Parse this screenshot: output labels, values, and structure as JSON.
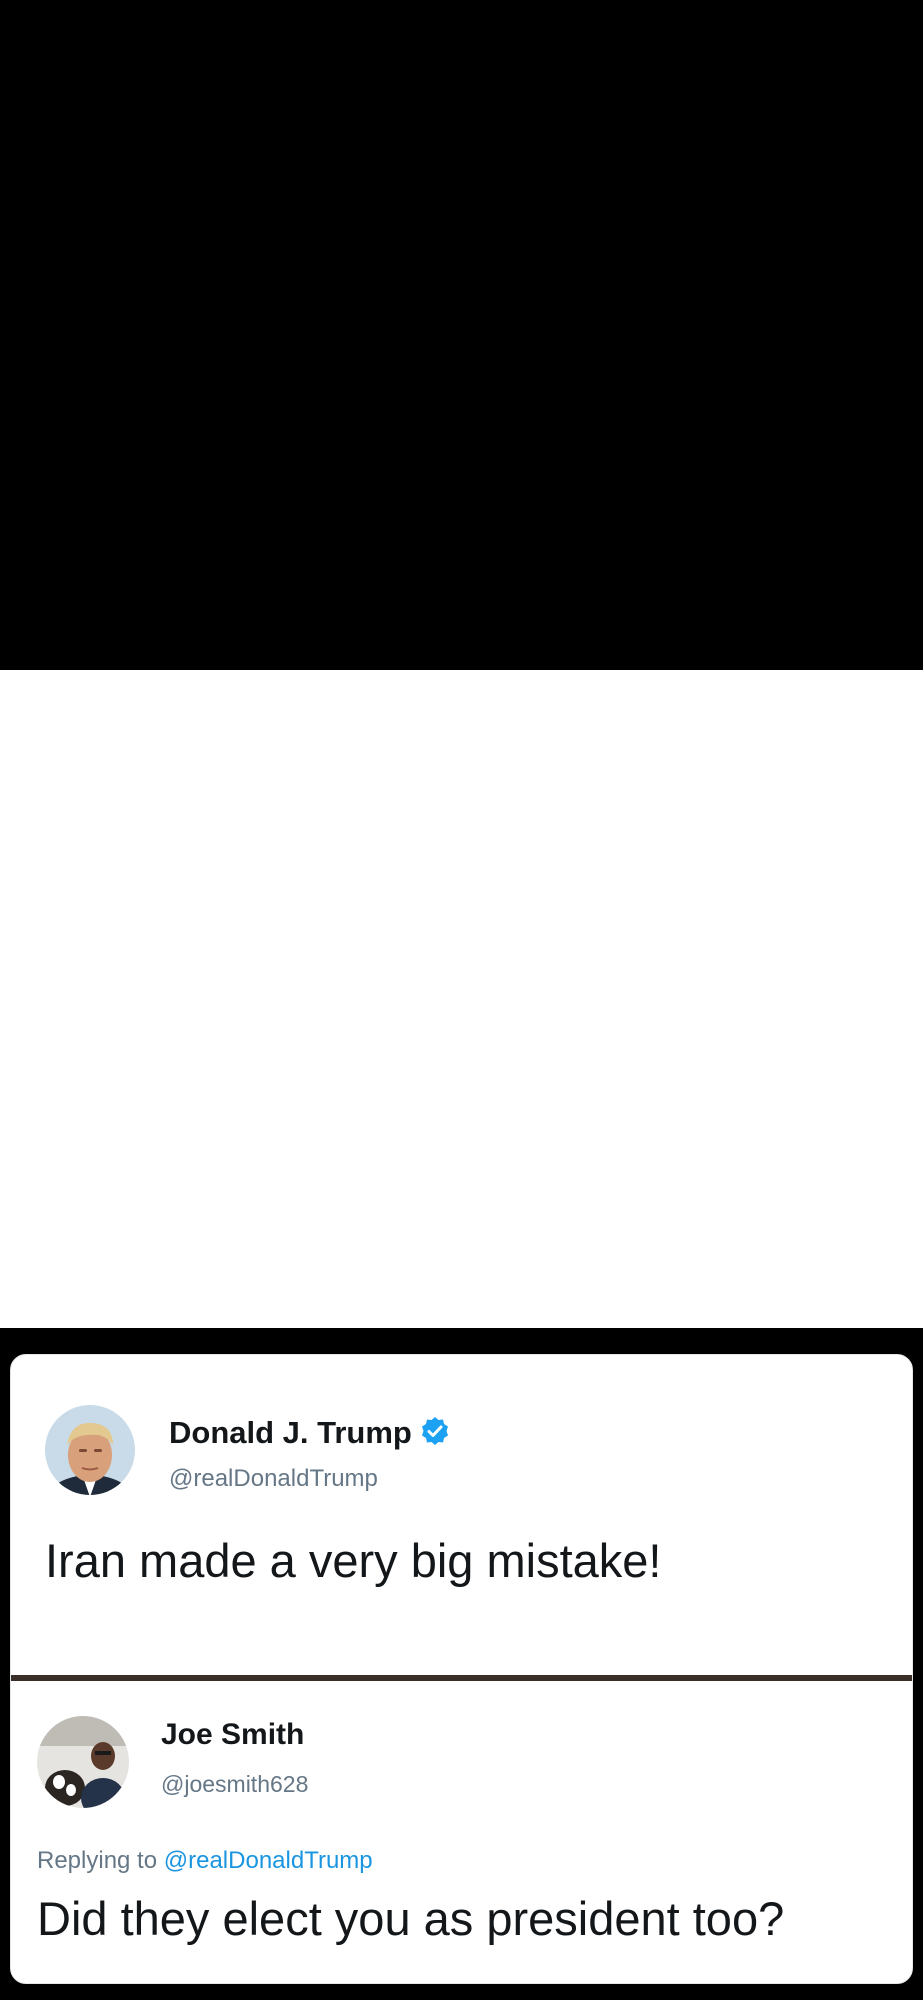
{
  "original_tweet": {
    "display_name": "Donald J. Trump",
    "handle": "@realDonaldTrump",
    "verified_icon": "verified-badge-icon",
    "text": "Iran made a very big mistake!"
  },
  "reply_tweet": {
    "display_name": "Joe Smith",
    "handle": "@joesmith628",
    "replying_to_prefix": "Replying to",
    "replying_to_handle": "@realDonaldTrump",
    "text": "Did they elect you as president too?"
  },
  "colors": {
    "background": "#000000",
    "card": "#ffffff",
    "name_text": "#14171a",
    "handle_text": "#657786",
    "mention_link": "#1b95e0",
    "verified_badge": "#1da1f2",
    "divider": "#3a2e28"
  }
}
